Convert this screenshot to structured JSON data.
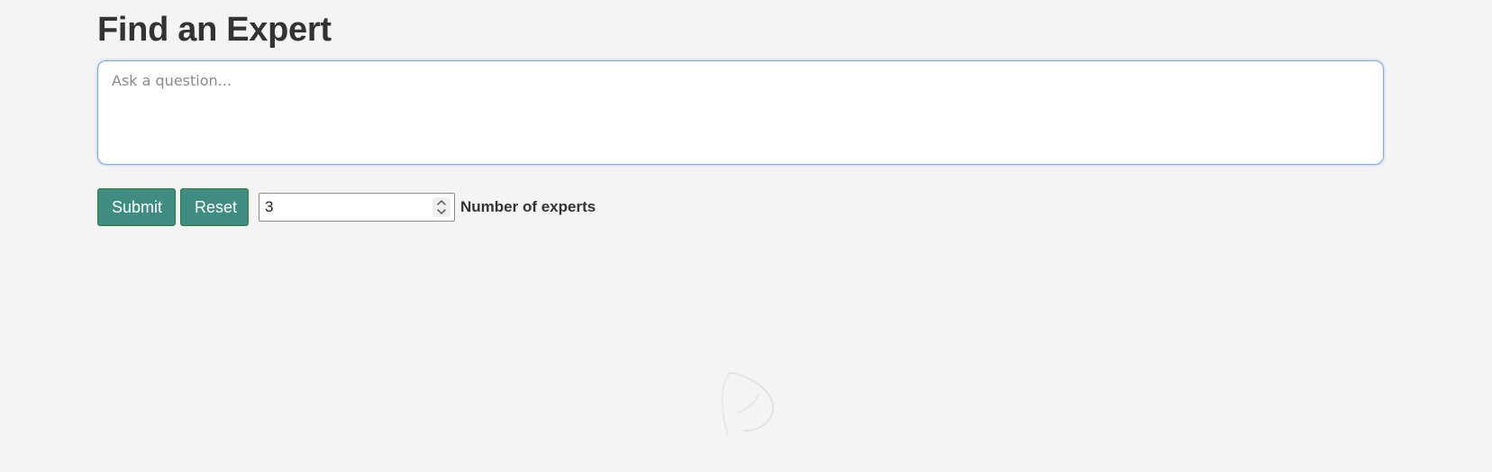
{
  "page": {
    "title": "Find an Expert"
  },
  "question": {
    "placeholder": "Ask a question...",
    "value": ""
  },
  "controls": {
    "submit_label": "Submit",
    "reset_label": "Reset",
    "experts_count": "3",
    "experts_label": "Number of experts"
  },
  "colors": {
    "background": "#f4f4f4",
    "button": "#3f8c80",
    "button_border": "#2f7a3a",
    "input_focus_border": "#7aaee8",
    "title_text": "#333333"
  },
  "icons": {
    "stepper": "number-stepper-icon",
    "loading": "loading-spinner-icon"
  }
}
